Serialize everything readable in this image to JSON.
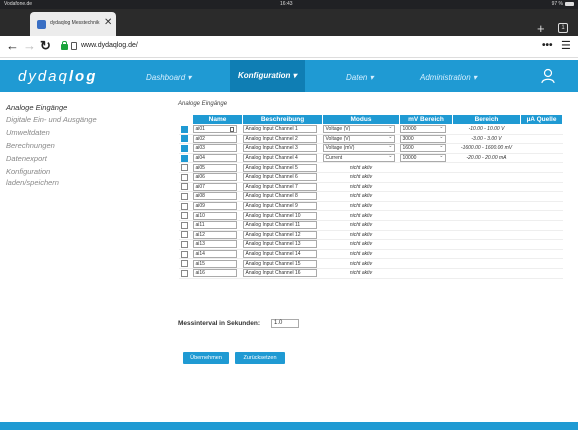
{
  "status": {
    "carrier": "Vodafone.de",
    "time": "16:43",
    "battery": "97 %"
  },
  "tab": {
    "title": "dydaqlog Messtechnik"
  },
  "address": {
    "url": "www.dydaqlog.de/"
  },
  "nav": {
    "logo_light": "dydaq",
    "logo_bold": "log",
    "items": [
      "Dashboard ▾",
      "Konfiguration ▾",
      "Daten ▾",
      "Administration ▾"
    ]
  },
  "sidebar": [
    "Analoge Eingänge",
    "Digitale Ein- und Ausgänge",
    "Umweltdaten",
    "Berechnungen",
    "Datenexport",
    "Konfiguration",
    "laden/speichern"
  ],
  "section_label": "Analoge Eingänge",
  "table": {
    "headers": [
      "Name",
      "Beschreibung",
      "Modus",
      "mV Bereich",
      "Bereich",
      "µA Quelle"
    ],
    "rows": [
      {
        "name": "ai01",
        "desc": "Analog Input Channel 1",
        "mode": "Voltage (V)",
        "mv": "10000",
        "range": "-10.00 - 10.00 V"
      },
      {
        "name": "ai02",
        "desc": "Analog Input Channel 2",
        "mode": "Voltage (V)",
        "mv": "3000",
        "range": "-3.00 - 3.00 V"
      },
      {
        "name": "ai03",
        "desc": "Analog Input Channel 3",
        "mode": "Voltage (mV)",
        "mv": "1600",
        "range": "-1600.00 - 1600.00 mV"
      },
      {
        "name": "ai04",
        "desc": "Analog Input Channel 4",
        "mode": "Current",
        "mv": "10000",
        "range": "-20.00 - 20.00 mA"
      },
      {
        "name": "ai05",
        "desc": "Analog Input Channel 5",
        "mode": "nicht aktiv"
      },
      {
        "name": "ai06",
        "desc": "Analog Input Channel 6",
        "mode": "nicht aktiv"
      },
      {
        "name": "ai07",
        "desc": "Analog Input Channel 7",
        "mode": "nicht aktiv"
      },
      {
        "name": "ai08",
        "desc": "Analog Input Channel 8",
        "mode": "nicht aktiv"
      },
      {
        "name": "ai09",
        "desc": "Analog Input Channel 9",
        "mode": "nicht aktiv"
      },
      {
        "name": "ai10",
        "desc": "Analog Input Channel 10",
        "mode": "nicht aktiv"
      },
      {
        "name": "ai11",
        "desc": "Analog Input Channel 11",
        "mode": "nicht aktiv"
      },
      {
        "name": "ai12",
        "desc": "Analog Input Channel 12",
        "mode": "nicht aktiv"
      },
      {
        "name": "ai13",
        "desc": "Analog Input Channel 13",
        "mode": "nicht aktiv"
      },
      {
        "name": "ai14",
        "desc": "Analog Input Channel 14",
        "mode": "nicht aktiv"
      },
      {
        "name": "ai15",
        "desc": "Analog Input Channel 15",
        "mode": "nicht aktiv"
      },
      {
        "name": "ai16",
        "desc": "Analog Input Channel 16",
        "mode": "nicht aktiv"
      }
    ]
  },
  "interval": {
    "label": "Messinterval in Sekunden:",
    "value": "1.0"
  },
  "buttons": {
    "apply": "Übernehmen",
    "reset": "Zurücksetzen"
  },
  "colors": {
    "brand": "#1f9ad3",
    "nav_active": "#0f7eb4"
  }
}
